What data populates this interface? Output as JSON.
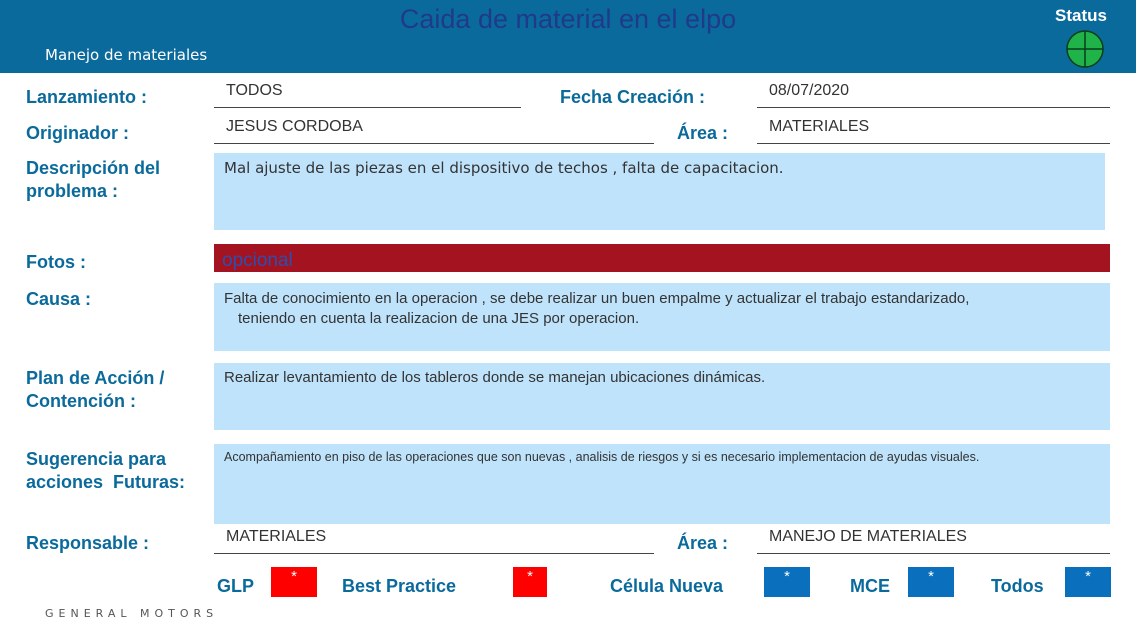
{
  "header": {
    "title": "Caida de material en el elpo",
    "subtitle": "Manejo de materiales",
    "status_label": "Status",
    "status_icon": "green-crosshair-circle-icon",
    "status_color": "#1fb34a"
  },
  "fields": {
    "lanzamiento": {
      "label": "Lanzamiento :",
      "value": "TODOS"
    },
    "fecha_creacion": {
      "label": "Fecha Creación :",
      "value": "08/07/2020"
    },
    "originador": {
      "label": "Originador :",
      "value": "JESUS CORDOBA"
    },
    "area1": {
      "label": "Área :",
      "value": "MATERIALES"
    },
    "descripcion": {
      "label_line1": "Descripción del",
      "label_line2": "problema :",
      "value": "Mal ajuste de las piezas en el dispositivo de techos , falta de capacitacion."
    },
    "fotos": {
      "label": "Fotos :",
      "value": "opcional"
    },
    "causa": {
      "label": "Causa :",
      "value_line1": "Falta de conocimiento en la operacion , se debe realizar un buen empalme y actualizar el trabajo estandarizado,",
      "value_line2": "teniendo en cuenta la realizacion de una JES por operacion."
    },
    "plan": {
      "label_line1": "Plan de Acción /",
      "label_line2": "Contención :",
      "value": "Realizar levantamiento de los tableros donde se manejan ubicaciones dinámicas."
    },
    "sugerencia": {
      "label_line1": "Sugerencia para",
      "label_line2": "acciones  Futuras:",
      "value": "Acompañamiento en piso de las operaciones que son nuevas , analisis de riesgos y si es necesario implementacion de ayudas visuales."
    },
    "responsable": {
      "label": "Responsable :",
      "value": "MATERIALES"
    },
    "area2": {
      "label": "Área :",
      "value": "MANEJO DE MATERIALES"
    }
  },
  "footer_tags": [
    {
      "label": "GLP",
      "mark": "*",
      "color": "#ff0000"
    },
    {
      "label": "Best Practice",
      "mark": "*",
      "color": "#ff0000"
    },
    {
      "label": "Célula Nueva",
      "mark": "*",
      "color": "#0a6fbd"
    },
    {
      "label": "MCE",
      "mark": "*",
      "color": "#0a6fbd"
    },
    {
      "label": "Todos",
      "mark": "*",
      "color": "#0a6fbd"
    }
  ],
  "footer_logo": "GENERAL MOTORS"
}
